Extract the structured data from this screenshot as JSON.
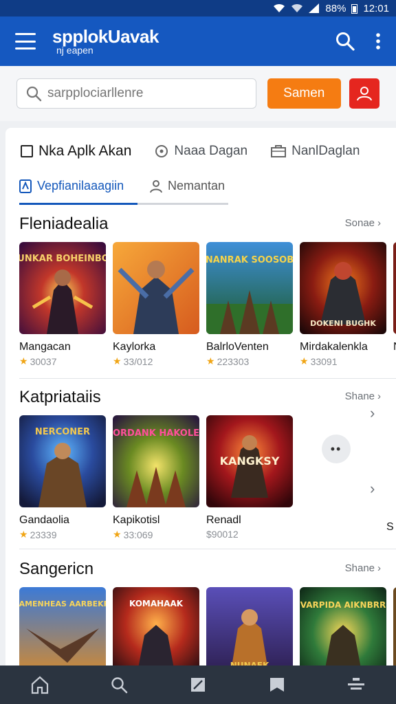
{
  "status": {
    "battery": "88%",
    "time": "12:01"
  },
  "appbar": {
    "brand_title": "spplokUavak",
    "brand_sub": "nj    eapen"
  },
  "search": {
    "placeholder": "sarpplociarllenre",
    "button_label": "Samen"
  },
  "filters": {
    "f1": "Nka Aplk Akan",
    "f2": "Naaa Dagan",
    "f3": "NanlDaglan"
  },
  "tabs": {
    "active": "Vepfianilaaagiin",
    "other": "Nemantan"
  },
  "sections": [
    {
      "title": "Fleniadealia",
      "more": "Sonae",
      "items": [
        {
          "name": "Mangacan",
          "rating": "30037",
          "art": "MUNKAR BOHEINBON"
        },
        {
          "name": "Kaylorka",
          "rating": "33/012",
          "art": ""
        },
        {
          "name": "BalrloVenten",
          "rating": "223303",
          "art": "NANRAK SOOSOB"
        },
        {
          "name": "Mirdakalenkla",
          "rating": "33091",
          "art": "DOKENI BUGHK"
        },
        {
          "name": "N",
          "rating": "",
          "art": ""
        }
      ]
    },
    {
      "title": "Katpriataiis",
      "more": "Shane",
      "items": [
        {
          "name": "Gandaolia",
          "rating": "23339",
          "art": "NERCONER"
        },
        {
          "name": "Kapikotisl",
          "rating": "33:069",
          "art": "ORDANK HAKOLE"
        },
        {
          "name": "Renadl",
          "rating": "$90012",
          "art": "KANGKSY"
        },
        {
          "name": "S",
          "rating": "",
          "art": ""
        }
      ]
    },
    {
      "title": "Sangericn",
      "more": "Shane",
      "items": [
        {
          "name": "",
          "rating": "",
          "art": "DIAMENHEAS AARBEKRA"
        },
        {
          "name": "",
          "rating": "",
          "art": "KOMAHAAK"
        },
        {
          "name": "",
          "rating": "",
          "art": "NUNAEK"
        },
        {
          "name": "",
          "rating": "",
          "art": "VARPIDA AIKNBRR"
        },
        {
          "name": "",
          "rating": "",
          "art": ""
        }
      ]
    }
  ],
  "colors": {
    "appbar": "#1558c0",
    "accent_orange": "#f57c12",
    "accent_red": "#e5261f",
    "tab_active": "#1458bb",
    "nav_bg": "#2b3440"
  },
  "icons": {
    "menu": "hamburger-icon",
    "search": "search-icon",
    "more": "kebab-icon",
    "user": "user-icon",
    "home": "home-icon",
    "edit": "edit-icon",
    "bookmark": "bookmark-icon",
    "queue": "queue-icon"
  }
}
